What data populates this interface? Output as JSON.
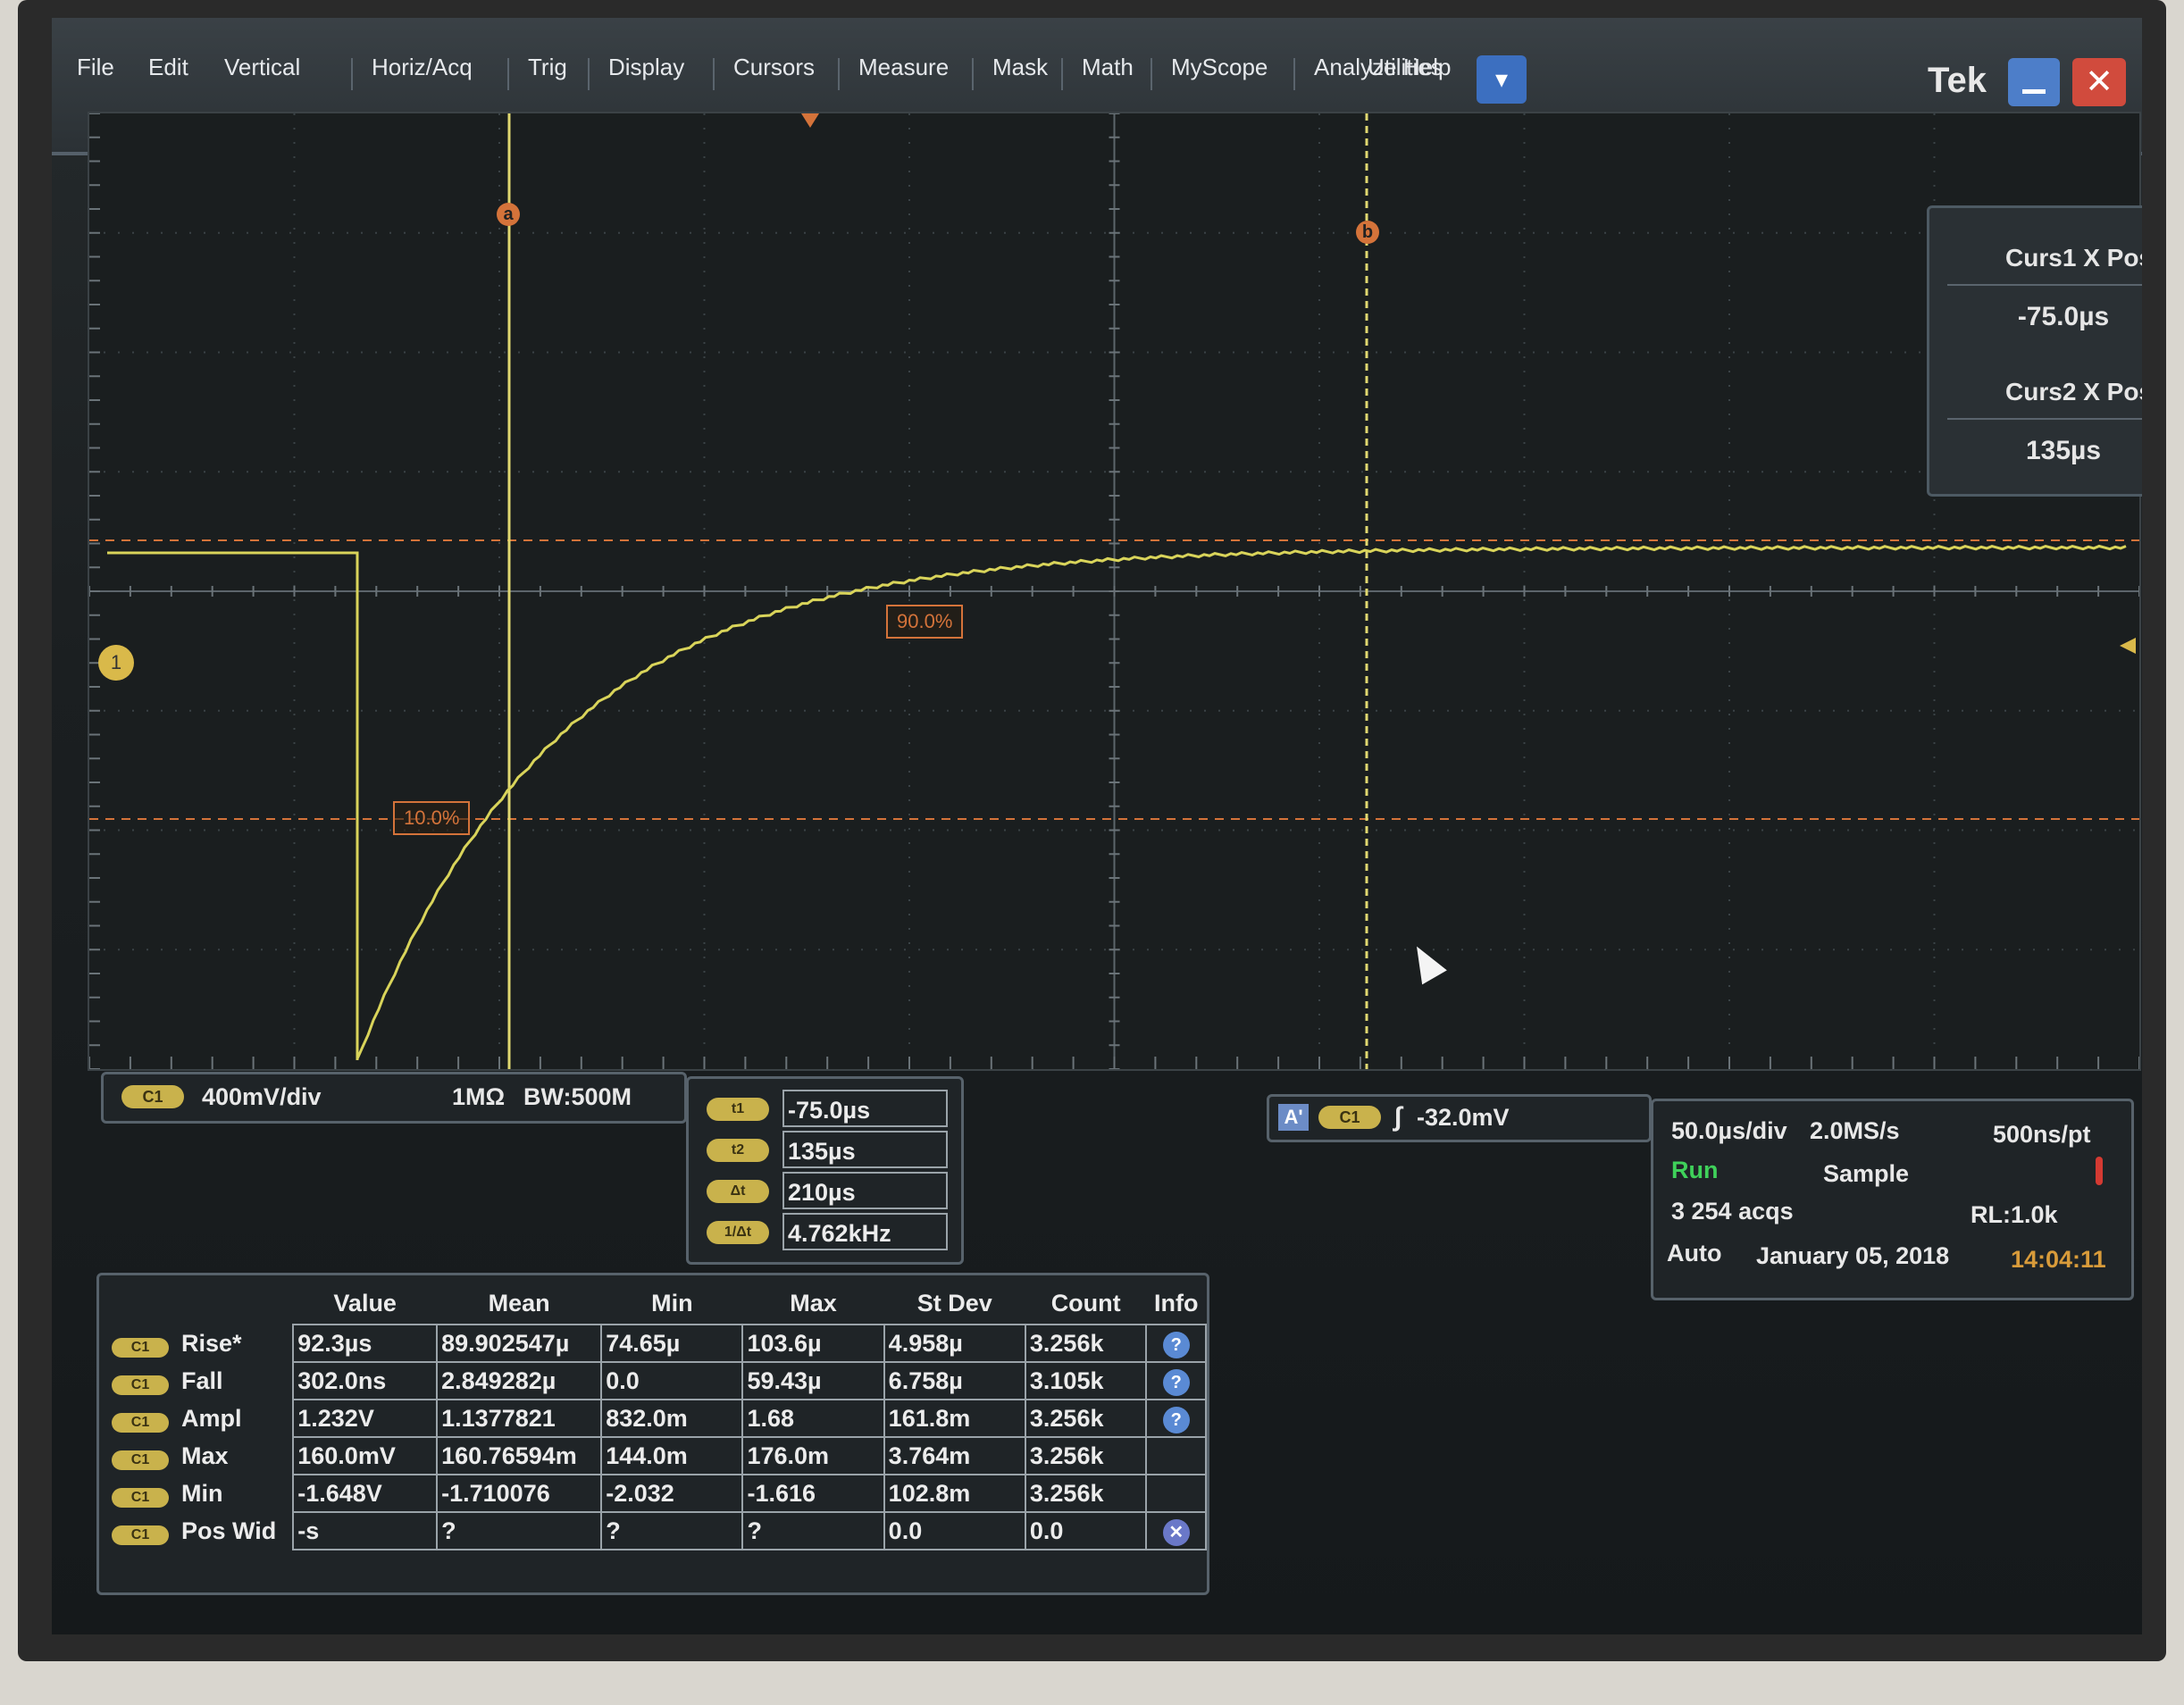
{
  "menu": {
    "items": [
      "File",
      "Edit",
      "Vertical",
      "Horiz/Acq",
      "Trig",
      "Display",
      "Cursors",
      "Measure",
      "Mask",
      "Math",
      "MyScope",
      "Analyze",
      "Utilities",
      "Help"
    ],
    "brand": "Tek"
  },
  "cursors": {
    "label_a": "a",
    "label_b": "b",
    "curs1_title": "Curs1 X Pos",
    "curs1_value": "-75.0µs",
    "curs2_title": "Curs2 X Pos",
    "curs2_value": "135µs"
  },
  "graticule": {
    "channel_marker": "1",
    "ref_low": "10.0%",
    "ref_high": "90.0%"
  },
  "channel": {
    "pill": "C1",
    "scale": "400mV/div",
    "impedance": "1MΩ",
    "bandwidth": "BW:500M"
  },
  "cursor_readout": {
    "rows": [
      {
        "label": "t1",
        "value": "-75.0µs"
      },
      {
        "label": "t2",
        "value": "135µs"
      },
      {
        "label": "Δt",
        "value": "210µs"
      },
      {
        "label": "1/Δt",
        "value": "4.762kHz"
      }
    ]
  },
  "trigger": {
    "mode_badge": "A'",
    "source": "C1",
    "level": "-32.0mV"
  },
  "acquisition": {
    "timebase": "50.0µs/div",
    "sample_rate": "2.0MS/s",
    "resolution": "500ns/pt",
    "run_state": "Run",
    "mode": "Sample",
    "acqs": "3 254 acqs",
    "record_length": "RL:1.0k",
    "trigger_mode": "Auto",
    "date": "January 05, 2018",
    "time": "14:04:11"
  },
  "measurements": {
    "headers": [
      "Value",
      "Mean",
      "Min",
      "Max",
      "St Dev",
      "Count",
      "Info"
    ],
    "rows": [
      {
        "ch": "C1",
        "name": "Rise*",
        "value": "92.3µs",
        "mean": "89.902547µ",
        "min": "74.65µ",
        "max": "103.6µ",
        "stdev": "4.958µ",
        "count": "3.256k",
        "info": "?"
      },
      {
        "ch": "C1",
        "name": "Fall",
        "value": "302.0ns",
        "mean": "2.849282µ",
        "min": "0.0",
        "max": "59.43µ",
        "stdev": "6.758µ",
        "count": "3.105k",
        "info": "?"
      },
      {
        "ch": "C1",
        "name": "Ampl",
        "value": "1.232V",
        "mean": "1.1377821",
        "min": "832.0m",
        "max": "1.68",
        "stdev": "161.8m",
        "count": "3.256k",
        "info": "?"
      },
      {
        "ch": "C1",
        "name": "Max",
        "value": "160.0mV",
        "mean": "160.76594m",
        "min": "144.0m",
        "max": "176.0m",
        "stdev": "3.764m",
        "count": "3.256k",
        "info": ""
      },
      {
        "ch": "C1",
        "name": "Min",
        "value": "-1.648V",
        "mean": "-1.710076",
        "min": "-2.032",
        "max": "-1.616",
        "stdev": "102.8m",
        "count": "3.256k",
        "info": ""
      },
      {
        "ch": "C1",
        "name": "Pos Wid",
        "value": "-s",
        "mean": "?",
        "min": "?",
        "max": "?",
        "stdev": "0.0",
        "count": "0.0",
        "info": "x"
      }
    ]
  },
  "colors": {
    "waveform": "#d9d45a",
    "cursor": "#e0d870",
    "reference": "#d4733a",
    "accent": "#3c6fc0"
  }
}
